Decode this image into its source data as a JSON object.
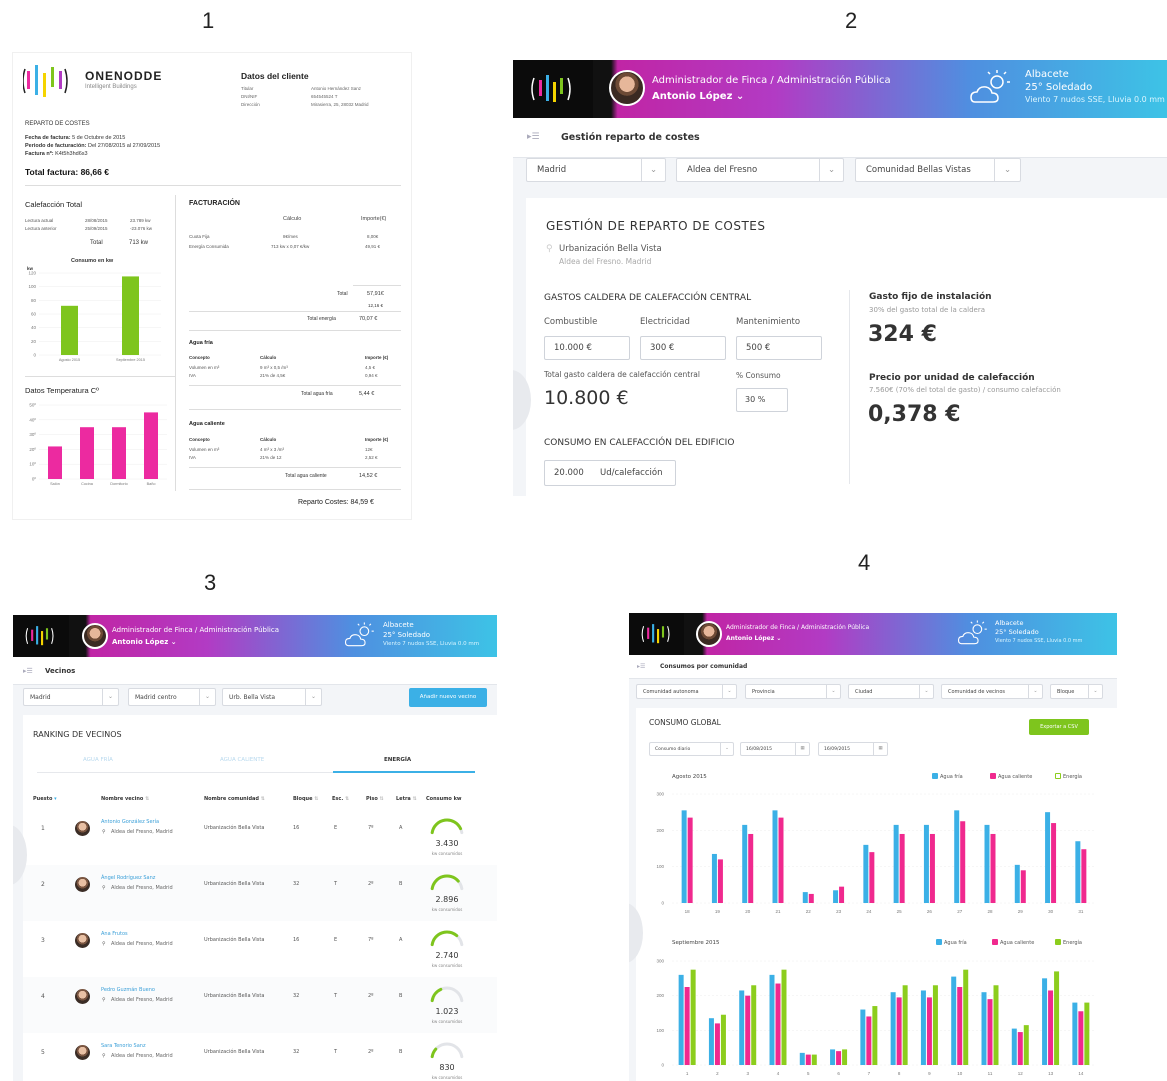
{
  "numbers": [
    "1",
    "2",
    "3",
    "4"
  ],
  "invoice": {
    "brand": "ONENODDE",
    "brand_sub": "Intelligent Buildings",
    "client_title": "Datos del cliente",
    "client": [
      {
        "k": "Titular",
        "v": "Antonio Hernández Sanz"
      },
      {
        "k": "DNI/NIF",
        "v": "654545524 T"
      },
      {
        "k": "Dirección",
        "v": "Mirasierra, 25, 28032 Madrid"
      }
    ],
    "reparto_title": "REPARTO DE COSTES",
    "fecha_label": "Fecha de factura:",
    "fecha_value": "5 de Octubre de 2015",
    "periodo_label": "Periodo de facturación:",
    "periodo_value": "Del 27/08/2015 al 27/09/2015",
    "factura_label": "Factura nº:",
    "factura_value": "K4t5h3hd6s3",
    "total_label": "Total factura: 86,66 €",
    "calef_title": "Calefacción Total",
    "lect_actual": "Lectura actual",
    "lect_actual_d": "28/08/2015",
    "lect_actual_v": "23.789 kw",
    "lect_ant": "Lectura anterior",
    "lect_ant_d": "25/09/2015",
    "lect_ant_v": "-23.076 kw",
    "total_word": "Total",
    "total_kw": "713 kw",
    "consumo_title": "Consumo en kw",
    "temp_title": "Datos Temperatura Cº",
    "fact_title": "FACTURACIÓN",
    "calc_col": "Cálculo",
    "imp_col": "Importe(€)",
    "cuota_label": "Cuota Fija",
    "cuota_calc": "8€/mes",
    "cuota_imp": "8,00€",
    "energia_label": "Energía Consumida",
    "energia_calc": "713 kw x 0,07 €/kw",
    "energia_imp": "49,91 €",
    "total_val": "57,91€",
    "iva_val": "12,16 €",
    "total_energia_label": "Total energía",
    "total_energia_val": "70,07 €",
    "agua_fria_title": "Agua fría",
    "concepto": "Concepto",
    "calculo": "Cálculo",
    "importe": "Importe (€)",
    "af_vol_label": "Volumen en m³",
    "af_vol_calc": "9 m³ x 0,5 /m³",
    "af_vol_imp": "4,5 €",
    "af_iva_label": "IVA",
    "af_iva_calc": "21% de 4,5€",
    "af_iva_imp": "0,94 €",
    "af_total_label": "Total agua fría",
    "af_total_val": "5,44 €",
    "agua_cal_title": "Agua caliente",
    "ac_vol_label": "Volumen en m³",
    "ac_vol_calc": "4 m³ x 3 /m³",
    "ac_vol_imp": "12€",
    "ac_iva_label": "IVA",
    "ac_iva_calc": "21% de 12",
    "ac_iva_imp": "2,52 €",
    "ac_total_label": "Total agua caliente",
    "ac_total_val": "14,52 €",
    "reparto_total": "Reparto Costes: 84,59 €"
  },
  "header": {
    "role": "Administrador de Finca / Administración Pública",
    "user": "Antonio López",
    "city": "Albacete",
    "temp": "25° Soledado",
    "wind": "Viento 7 nudos SSE, Lluvia 0.0 mm"
  },
  "panel2": {
    "section": "Gestión reparto de costes",
    "selects": [
      "Madrid",
      "Aldea del Fresno",
      "Comunidad Bellas Vistas"
    ],
    "title": "GESTIÓN DE REPARTO DE COSTES",
    "loc1": "Urbanización Bella Vista",
    "loc2": "Aldea del Fresno. Madrid",
    "gastos_title": "GASTOS CALDERA DE CALEFACCIÓN CENTRAL",
    "combustible": "Combustible",
    "electricidad": "Electricidad",
    "mantenimiento": "Mantenimiento",
    "combustible_v": "10.000 €",
    "electricidad_v": "300 €",
    "mantenimiento_v": "500 €",
    "total_label": "Total gasto caldera de calefacción central",
    "consumo_pct_label": "% Consumo",
    "total_value": "10.800 €",
    "consumo_pct_value": "30 %",
    "consumo_title": "CONSUMO EN CALEFACCIÓN DEL EDIFICIO",
    "consumo_value": "20.000",
    "consumo_unit": "Ud/calefacción",
    "gasto_fijo_title": "Gasto fijo de instalación",
    "gasto_fijo_sub": "30% del gasto total de la caldera",
    "gasto_fijo_value": "324 €",
    "precio_title": "Precio por unidad de calefacción",
    "precio_sub": "7.560€ (70% del total de gasto) / consumo calefacción",
    "precio_value": "0,378 €"
  },
  "panel3": {
    "section": "Vecinos",
    "selects": [
      "Madrid",
      "Madrid centro",
      "Urb. Bella Vista"
    ],
    "add_button": "Añadir nuevo vecino",
    "ranking_title": "RANKING DE VECINOS",
    "tabs": [
      "AGUA FRÍA",
      "AGUA CALIENTE",
      "ENERGÍA"
    ],
    "columns": [
      "Puesto",
      "Nombre vecino",
      "Nombre comunidad",
      "Bloque",
      "Esc.",
      "Piso",
      "Letra",
      "Consumo kw"
    ],
    "kw_caption": "kw consumidos",
    "rows": [
      {
        "pos": "1",
        "name": "Antonio González Sería",
        "loc": "Aldea del Fresno, Madrid",
        "com": "Urbanización Bella Vista",
        "bloque": "16",
        "esc": "E",
        "piso": "7º",
        "letra": "A",
        "kw": "3.430",
        "level": 0.9
      },
      {
        "pos": "2",
        "name": "Ángel Rodríguez Sanz",
        "loc": "Aldea del Fresno, Madrid",
        "com": "Urbanización Bella Vista",
        "bloque": "32",
        "esc": "T",
        "piso": "2º",
        "letra": "B",
        "kw": "2.896",
        "level": 0.8
      },
      {
        "pos": "3",
        "name": "Ana Frutos",
        "loc": "Aldea del Fresno, Madrid",
        "com": "Urbanización Bella Vista",
        "bloque": "16",
        "esc": "E",
        "piso": "7º",
        "letra": "A",
        "kw": "2.740",
        "level": 0.75
      },
      {
        "pos": "4",
        "name": "Pedro Guzmán Bueno",
        "loc": "Aldea del Fresno, Madrid",
        "com": "Urbanización Bella Vista",
        "bloque": "32",
        "esc": "T",
        "piso": "2º",
        "letra": "B",
        "kw": "1.023",
        "level": 0.35
      },
      {
        "pos": "5",
        "name": "Sara Tenorio Sanz",
        "loc": "Aldea del Fresno, Madrid",
        "com": "Urbanización Bella Vista",
        "bloque": "32",
        "esc": "T",
        "piso": "2º",
        "letra": "B",
        "kw": "830",
        "level": 0.2
      }
    ]
  },
  "panel4": {
    "section": "Consumos por comunidad",
    "selects": [
      "Comunidad autonoma",
      "Provincia",
      "Ciudad",
      "Comunidad de vecinos",
      "Bloque"
    ],
    "title": "CONSUMO GLOBAL",
    "export_button": "Exportar a CSV",
    "range_select": "Consumo diario",
    "date_from": "16/08/2015",
    "date_to": "16/09/2015",
    "legend": [
      "Agua fría",
      "Agua caliente",
      "Energía"
    ]
  },
  "colors": {
    "agua_fria": "#3bb0e6",
    "agua_caliente": "#f0298e",
    "energia": "#8ccd1d",
    "green": "#7ec51d",
    "pink": "#ec2aa0"
  },
  "chart_data": [
    {
      "type": "bar",
      "title": "Consumo en kw",
      "ylabel": "kw",
      "categories": [
        "Agosto 2015",
        "Septiembre 2015"
      ],
      "values": [
        72,
        115
      ],
      "ylim": [
        0,
        120
      ],
      "yticks": [
        "0",
        "20",
        "40",
        "60",
        "80",
        "100",
        "120"
      ]
    },
    {
      "type": "bar",
      "title": "Datos Temperatura Cº",
      "categories": [
        "Salón",
        "Cocina",
        "Dormitorio",
        "Baño"
      ],
      "values": [
        22,
        35,
        35,
        45
      ],
      "ylim": [
        0,
        50
      ],
      "yticks": [
        "0º",
        "10º",
        "20º",
        "30º",
        "40º",
        "50º"
      ]
    },
    {
      "type": "bar",
      "title": "Agosto 2015",
      "categories": [
        "18",
        "19",
        "20",
        "21",
        "22",
        "23",
        "24",
        "25",
        "26",
        "27",
        "28",
        "29",
        "30",
        "31"
      ],
      "ylim": [
        0,
        300
      ],
      "yticks": [
        "0",
        "100",
        "200",
        "300"
      ],
      "series": [
        {
          "name": "Agua fría",
          "values": [
            255,
            135,
            215,
            255,
            30,
            35,
            160,
            215,
            215,
            255,
            215,
            105,
            250,
            170
          ]
        },
        {
          "name": "Agua caliente",
          "values": [
            235,
            120,
            190,
            235,
            25,
            45,
            140,
            190,
            190,
            225,
            190,
            90,
            220,
            148
          ]
        }
      ]
    },
    {
      "type": "bar",
      "title": "Septiembre 2015",
      "categories": [
        "1",
        "2",
        "3",
        "4",
        "5",
        "6",
        "7",
        "8",
        "9",
        "10",
        "11",
        "12",
        "13",
        "14"
      ],
      "ylim": [
        0,
        300
      ],
      "yticks": [
        "0",
        "100",
        "200",
        "300"
      ],
      "series": [
        {
          "name": "Agua fría",
          "values": [
            260,
            135,
            215,
            260,
            35,
            45,
            160,
            210,
            215,
            255,
            210,
            105,
            250,
            180
          ]
        },
        {
          "name": "Agua caliente",
          "values": [
            225,
            120,
            200,
            235,
            30,
            40,
            140,
            195,
            195,
            225,
            190,
            95,
            215,
            155
          ]
        },
        {
          "name": "Energía",
          "values": [
            275,
            145,
            230,
            275,
            30,
            45,
            170,
            230,
            230,
            275,
            230,
            115,
            270,
            180
          ]
        }
      ]
    }
  ]
}
